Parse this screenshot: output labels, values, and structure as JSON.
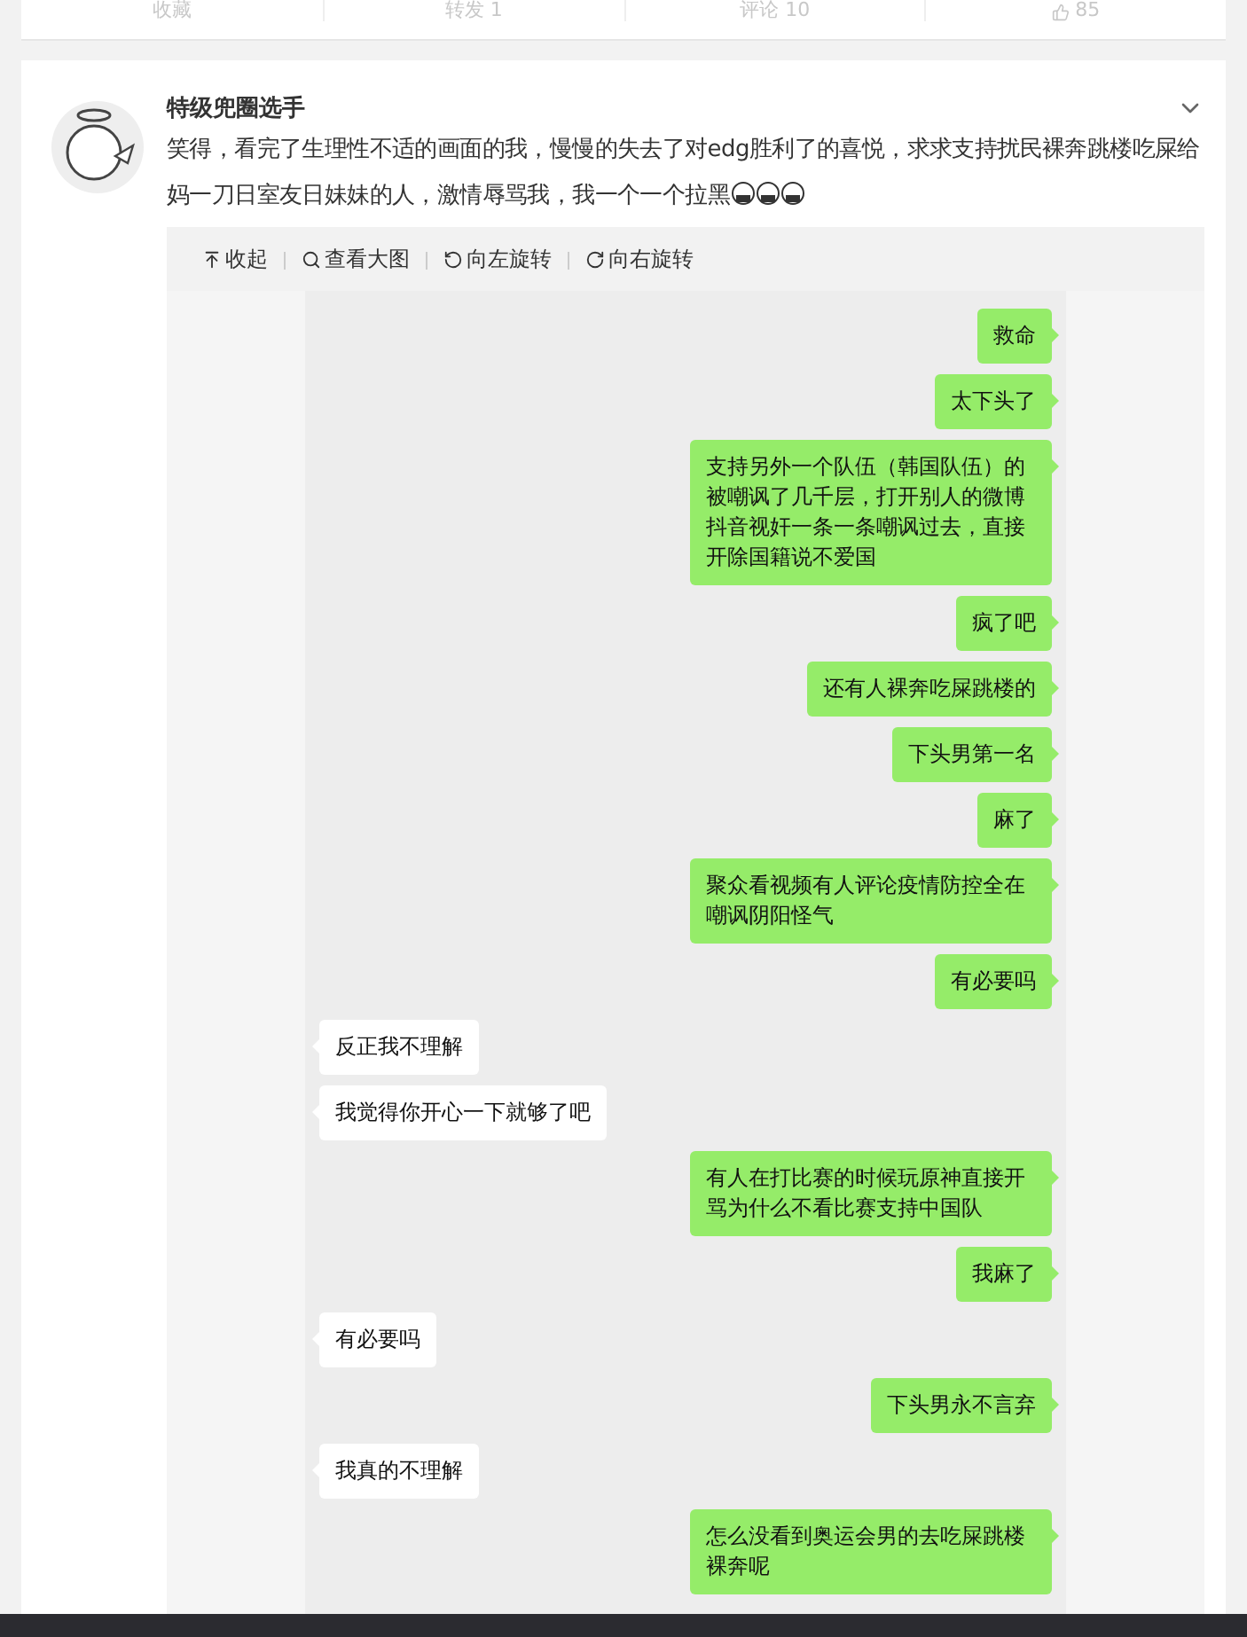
{
  "top_actions": [
    "收藏",
    "转发 1",
    "评论 10",
    "85"
  ],
  "post": {
    "author": "特级兜圈选手",
    "text": "笑得，看完了生理性不适的画面的我，慢慢的失去了对edg胜利了的喜悦，求求支持扰民裸奔跳楼吃屎给妈一刀日室友日妹妹的人，激情辱骂我，我一个一个拉黑",
    "emojis": [
      {
        "kind": "scream"
      },
      {
        "kind": "scream"
      },
      {
        "kind": "scream"
      }
    ]
  },
  "image_toolbar": [
    {
      "kind": "collapse",
      "label": "收起"
    },
    {
      "kind": "zoom",
      "label": "查看大图"
    },
    {
      "kind": "rotate-left",
      "label": "向左旋转"
    },
    {
      "kind": "rotate-right",
      "label": "向右旋转"
    }
  ],
  "messages": [
    {
      "kind": "sent",
      "text": "救命"
    },
    {
      "kind": "sent",
      "text": "太下头了"
    },
    {
      "kind": "sent",
      "text": "支持另外一个队伍（韩国队伍）的被嘲讽了几千层，打开别人的微博抖音视奸一条一条嘲讽过去，直接开除国籍说不爱国"
    },
    {
      "kind": "sent",
      "text": "疯了吧"
    },
    {
      "kind": "sent",
      "text": "还有人裸奔吃屎跳楼的"
    },
    {
      "kind": "sent",
      "text": "下头男第一名"
    },
    {
      "kind": "sent",
      "text": "麻了"
    },
    {
      "kind": "sent",
      "text": "聚众看视频有人评论疫情防控全在嘲讽阴阳怪气"
    },
    {
      "kind": "sent",
      "text": "有必要吗"
    },
    {
      "kind": "received",
      "text": "反正我不理解"
    },
    {
      "kind": "received",
      "text": "我觉得你开心一下就够了吧"
    },
    {
      "kind": "sent",
      "text": "有人在打比赛的时候玩原神直接开骂为什么不看比赛支持中国队"
    },
    {
      "kind": "sent",
      "text": "我麻了"
    },
    {
      "kind": "received",
      "text": "有必要吗"
    },
    {
      "kind": "sent",
      "text": "下头男永不言弃"
    },
    {
      "kind": "received",
      "text": "我真的不理解"
    },
    {
      "kind": "sent",
      "text": "怎么没看到奥运会男的去吃屎跳楼裸奔呢"
    }
  ]
}
